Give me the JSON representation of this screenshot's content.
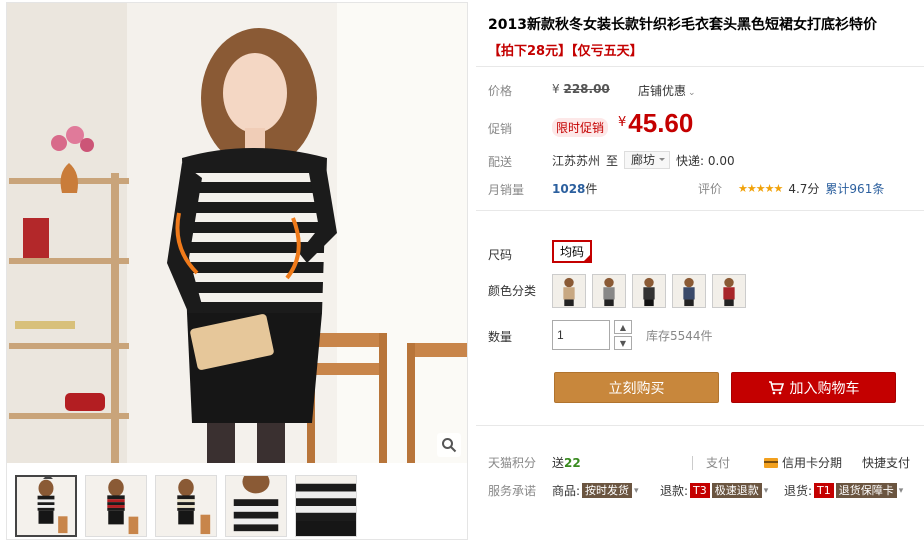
{
  "product": {
    "title": "2013新款秋冬女装长款针织衫毛衣套头黑色短裙女打底衫特价",
    "subtitle": "【拍下28元】【仅亏五天】"
  },
  "price": {
    "label": "价格",
    "currency": "¥",
    "original": "228.00",
    "shop_discount": "店铺优惠",
    "promo_label": "促销",
    "promo_tag": "限时促销",
    "promo_price": "45.60"
  },
  "shipping": {
    "label": "配送",
    "from": "江苏苏州",
    "to_word": "至",
    "destination": "廊坊",
    "fee": "快递: 0.00"
  },
  "sales": {
    "label": "月销量",
    "count": "1028",
    "unit": "件"
  },
  "rating": {
    "label": "评价",
    "stars": "★★★★★",
    "score": "4.7分",
    "total": "累计961条"
  },
  "options": {
    "size_label": "尺码",
    "size_value": "均码",
    "color_label": "颜色分类",
    "colors": [
      "beige-sweater",
      "gray-sweater",
      "black-sweater",
      "navy-sweater",
      "red-sweater"
    ]
  },
  "quantity": {
    "label": "数量",
    "value": "1",
    "stock": "库存5544件"
  },
  "buttons": {
    "buy": "立刻购买",
    "cart": "加入购物车"
  },
  "tmall": {
    "points_label": "天猫积分",
    "points_prefix": "送",
    "points_value": "22",
    "pay_label": "支付",
    "pay_card": "信用卡分期",
    "pay_quick": "快捷支付"
  },
  "service": {
    "label": "服务承诺",
    "goods_label": "商品:",
    "goods_tag": "按时发货",
    "refund_label": "退款:",
    "refund_code": "T3",
    "refund_tag": "极速退款",
    "return_label": "退货:",
    "return_code": "T1",
    "return_tag": "退货保障卡"
  },
  "colors": {
    "accent_red": "#c40000",
    "buy_orange": "#c8873c",
    "link_blue": "#2b5f9e",
    "points_green": "#3a8b20"
  }
}
